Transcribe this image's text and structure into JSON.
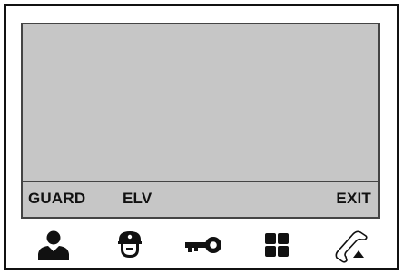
{
  "softkeys": {
    "left": "GUARD",
    "middle": "ELV",
    "right": "EXIT"
  },
  "buttons": [
    {
      "icon": "user-icon"
    },
    {
      "icon": "guard-icon"
    },
    {
      "icon": "key-icon"
    },
    {
      "icon": "menu-grid-icon"
    },
    {
      "icon": "phone-handset-icon"
    }
  ],
  "colors": {
    "screen": "#c6c6c6",
    "frame": "#111111",
    "icon": "#111111"
  }
}
